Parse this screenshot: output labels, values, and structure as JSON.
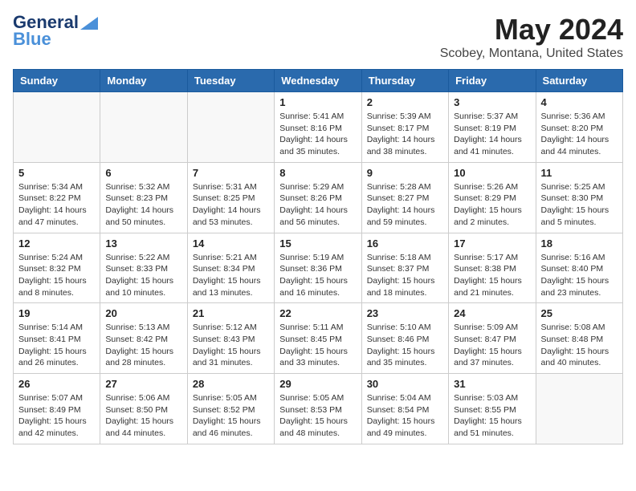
{
  "header": {
    "logo_line1": "General",
    "logo_line2": "Blue",
    "title": "May 2024",
    "subtitle": "Scobey, Montana, United States"
  },
  "days_of_week": [
    "Sunday",
    "Monday",
    "Tuesday",
    "Wednesday",
    "Thursday",
    "Friday",
    "Saturday"
  ],
  "weeks": [
    [
      {
        "day": "",
        "info": ""
      },
      {
        "day": "",
        "info": ""
      },
      {
        "day": "",
        "info": ""
      },
      {
        "day": "1",
        "info": "Sunrise: 5:41 AM\nSunset: 8:16 PM\nDaylight: 14 hours and 35 minutes."
      },
      {
        "day": "2",
        "info": "Sunrise: 5:39 AM\nSunset: 8:17 PM\nDaylight: 14 hours and 38 minutes."
      },
      {
        "day": "3",
        "info": "Sunrise: 5:37 AM\nSunset: 8:19 PM\nDaylight: 14 hours and 41 minutes."
      },
      {
        "day": "4",
        "info": "Sunrise: 5:36 AM\nSunset: 8:20 PM\nDaylight: 14 hours and 44 minutes."
      }
    ],
    [
      {
        "day": "5",
        "info": "Sunrise: 5:34 AM\nSunset: 8:22 PM\nDaylight: 14 hours and 47 minutes."
      },
      {
        "day": "6",
        "info": "Sunrise: 5:32 AM\nSunset: 8:23 PM\nDaylight: 14 hours and 50 minutes."
      },
      {
        "day": "7",
        "info": "Sunrise: 5:31 AM\nSunset: 8:25 PM\nDaylight: 14 hours and 53 minutes."
      },
      {
        "day": "8",
        "info": "Sunrise: 5:29 AM\nSunset: 8:26 PM\nDaylight: 14 hours and 56 minutes."
      },
      {
        "day": "9",
        "info": "Sunrise: 5:28 AM\nSunset: 8:27 PM\nDaylight: 14 hours and 59 minutes."
      },
      {
        "day": "10",
        "info": "Sunrise: 5:26 AM\nSunset: 8:29 PM\nDaylight: 15 hours and 2 minutes."
      },
      {
        "day": "11",
        "info": "Sunrise: 5:25 AM\nSunset: 8:30 PM\nDaylight: 15 hours and 5 minutes."
      }
    ],
    [
      {
        "day": "12",
        "info": "Sunrise: 5:24 AM\nSunset: 8:32 PM\nDaylight: 15 hours and 8 minutes."
      },
      {
        "day": "13",
        "info": "Sunrise: 5:22 AM\nSunset: 8:33 PM\nDaylight: 15 hours and 10 minutes."
      },
      {
        "day": "14",
        "info": "Sunrise: 5:21 AM\nSunset: 8:34 PM\nDaylight: 15 hours and 13 minutes."
      },
      {
        "day": "15",
        "info": "Sunrise: 5:19 AM\nSunset: 8:36 PM\nDaylight: 15 hours and 16 minutes."
      },
      {
        "day": "16",
        "info": "Sunrise: 5:18 AM\nSunset: 8:37 PM\nDaylight: 15 hours and 18 minutes."
      },
      {
        "day": "17",
        "info": "Sunrise: 5:17 AM\nSunset: 8:38 PM\nDaylight: 15 hours and 21 minutes."
      },
      {
        "day": "18",
        "info": "Sunrise: 5:16 AM\nSunset: 8:40 PM\nDaylight: 15 hours and 23 minutes."
      }
    ],
    [
      {
        "day": "19",
        "info": "Sunrise: 5:14 AM\nSunset: 8:41 PM\nDaylight: 15 hours and 26 minutes."
      },
      {
        "day": "20",
        "info": "Sunrise: 5:13 AM\nSunset: 8:42 PM\nDaylight: 15 hours and 28 minutes."
      },
      {
        "day": "21",
        "info": "Sunrise: 5:12 AM\nSunset: 8:43 PM\nDaylight: 15 hours and 31 minutes."
      },
      {
        "day": "22",
        "info": "Sunrise: 5:11 AM\nSunset: 8:45 PM\nDaylight: 15 hours and 33 minutes."
      },
      {
        "day": "23",
        "info": "Sunrise: 5:10 AM\nSunset: 8:46 PM\nDaylight: 15 hours and 35 minutes."
      },
      {
        "day": "24",
        "info": "Sunrise: 5:09 AM\nSunset: 8:47 PM\nDaylight: 15 hours and 37 minutes."
      },
      {
        "day": "25",
        "info": "Sunrise: 5:08 AM\nSunset: 8:48 PM\nDaylight: 15 hours and 40 minutes."
      }
    ],
    [
      {
        "day": "26",
        "info": "Sunrise: 5:07 AM\nSunset: 8:49 PM\nDaylight: 15 hours and 42 minutes."
      },
      {
        "day": "27",
        "info": "Sunrise: 5:06 AM\nSunset: 8:50 PM\nDaylight: 15 hours and 44 minutes."
      },
      {
        "day": "28",
        "info": "Sunrise: 5:05 AM\nSunset: 8:52 PM\nDaylight: 15 hours and 46 minutes."
      },
      {
        "day": "29",
        "info": "Sunrise: 5:05 AM\nSunset: 8:53 PM\nDaylight: 15 hours and 48 minutes."
      },
      {
        "day": "30",
        "info": "Sunrise: 5:04 AM\nSunset: 8:54 PM\nDaylight: 15 hours and 49 minutes."
      },
      {
        "day": "31",
        "info": "Sunrise: 5:03 AM\nSunset: 8:55 PM\nDaylight: 15 hours and 51 minutes."
      },
      {
        "day": "",
        "info": ""
      }
    ]
  ]
}
